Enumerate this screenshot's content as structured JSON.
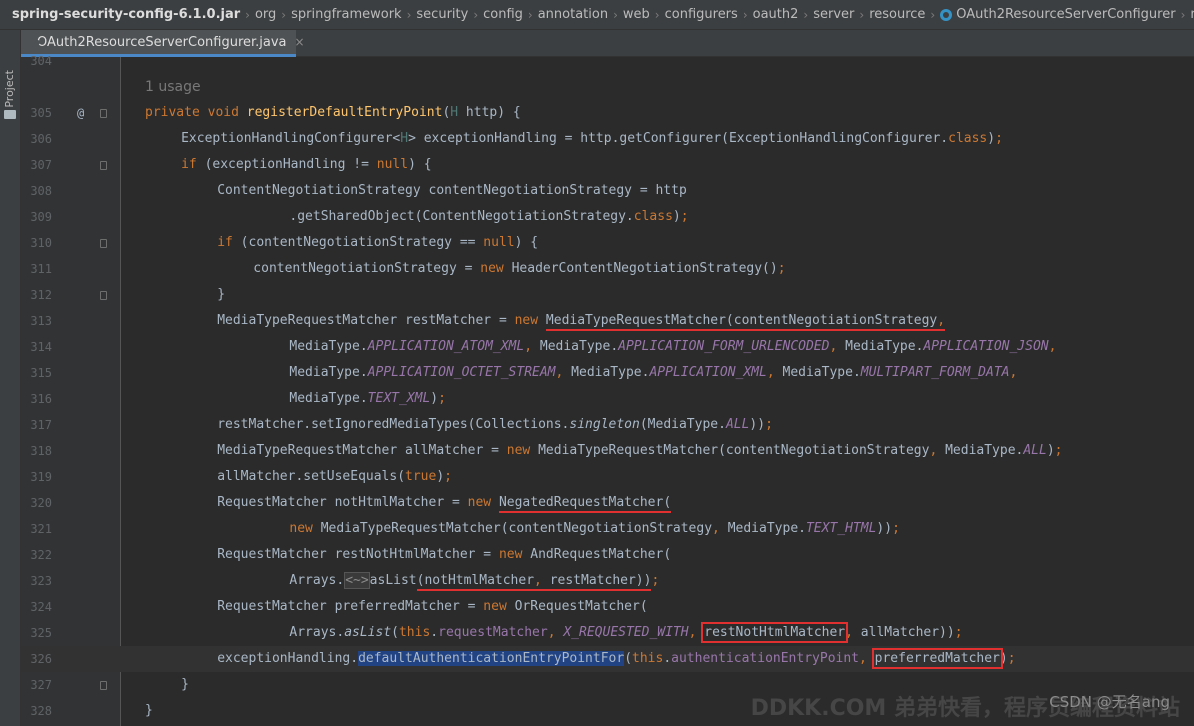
{
  "breadcrumb": {
    "items": [
      "spring-security-config-6.1.0.jar",
      "org",
      "springframework",
      "security",
      "config",
      "annotation",
      "web",
      "configurers",
      "oauth2",
      "server",
      "resource",
      "OAuth2ResourceServerConfigurer",
      "registerDefaultEntryPoint"
    ]
  },
  "sidebar": {
    "project_label": "Project"
  },
  "tabs": [
    {
      "label": "OAuth2ResourceServerConfigurer.java",
      "close_glyph": "×"
    }
  ],
  "editor": {
    "lines": [
      {
        "num": "304",
        "text": ""
      },
      {
        "num": "",
        "text": "1 usage"
      },
      {
        "num": "305",
        "text": "private void registerDefaultEntryPoint(H http) {",
        "marker": "@"
      },
      {
        "num": "306",
        "text": "ExceptionHandlingConfigurer<H> exceptionHandling = http.getConfigurer(ExceptionHandlingConfigurer.class);"
      },
      {
        "num": "307",
        "text": "if (exceptionHandling != null) {"
      },
      {
        "num": "308",
        "text": "ContentNegotiationStrategy contentNegotiationStrategy = http"
      },
      {
        "num": "309",
        "text": ".getSharedObject(ContentNegotiationStrategy.class);"
      },
      {
        "num": "310",
        "text": "if (contentNegotiationStrategy == null) {"
      },
      {
        "num": "311",
        "text": "contentNegotiationStrategy = new HeaderContentNegotiationStrategy();"
      },
      {
        "num": "312",
        "text": "}"
      },
      {
        "num": "313",
        "text": "MediaTypeRequestMatcher restMatcher = new MediaTypeRequestMatcher(contentNegotiationStrategy,"
      },
      {
        "num": "314",
        "text": "MediaType.APPLICATION_ATOM_XML, MediaType.APPLICATION_FORM_URLENCODED, MediaType.APPLICATION_JSON,"
      },
      {
        "num": "315",
        "text": "MediaType.APPLICATION_OCTET_STREAM, MediaType.APPLICATION_XML, MediaType.MULTIPART_FORM_DATA,"
      },
      {
        "num": "316",
        "text": "MediaType.TEXT_XML);"
      },
      {
        "num": "317",
        "text": "restMatcher.setIgnoredMediaTypes(Collections.singleton(MediaType.ALL));"
      },
      {
        "num": "318",
        "text": "MediaTypeRequestMatcher allMatcher = new MediaTypeRequestMatcher(contentNegotiationStrategy, MediaType.ALL);"
      },
      {
        "num": "319",
        "text": "allMatcher.setUseEquals(true);"
      },
      {
        "num": "320",
        "text": "RequestMatcher notHtmlMatcher = new NegatedRequestMatcher("
      },
      {
        "num": "321",
        "text": "new MediaTypeRequestMatcher(contentNegotiationStrategy, MediaType.TEXT_HTML));"
      },
      {
        "num": "322",
        "text": "RequestMatcher restNotHtmlMatcher = new AndRequestMatcher("
      },
      {
        "num": "323",
        "text": "Arrays.<~>asList(notHtmlMatcher, restMatcher));"
      },
      {
        "num": "324",
        "text": "RequestMatcher preferredMatcher = new OrRequestMatcher("
      },
      {
        "num": "325",
        "text": "Arrays.asList(this.requestMatcher, X_REQUESTED_WITH, restNotHtmlMatcher, allMatcher));"
      },
      {
        "num": "326",
        "text": "exceptionHandling.defaultAuthenticationEntryPointFor(this.authenticationEntryPoint, preferredMatcher);"
      },
      {
        "num": "327",
        "text": "}"
      },
      {
        "num": "328",
        "text": "}"
      }
    ]
  },
  "watermark": {
    "csdn": "CSDN @无名ang",
    "site": "DDKK.COM 弟弟快看，程序员编程资料站"
  },
  "colors": {
    "background": "#2b2b2b",
    "keyword": "#cc7832",
    "method": "#ffc66d",
    "field": "#9876aa",
    "type_param": "#507874",
    "annotation_red": "#e03030",
    "selection": "#214283"
  }
}
